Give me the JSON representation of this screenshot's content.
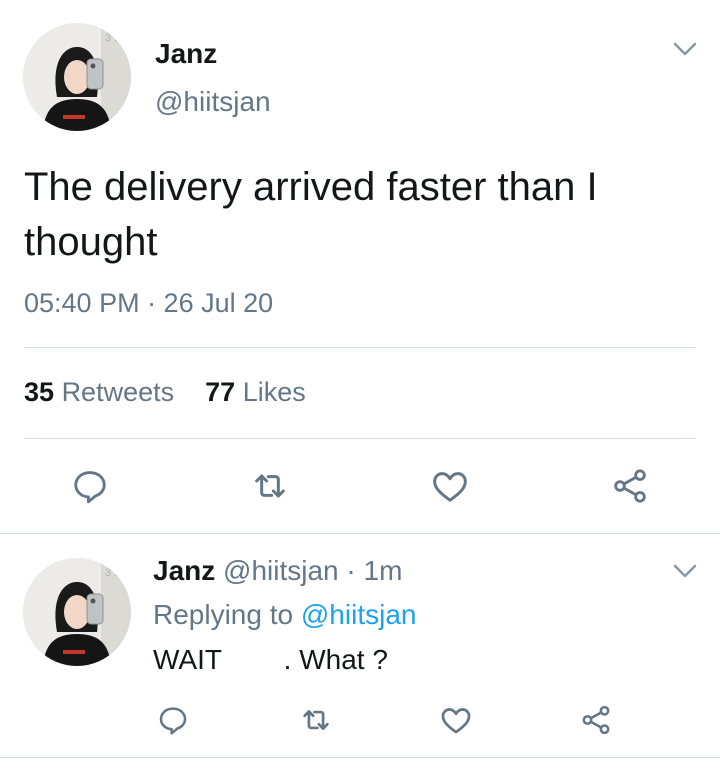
{
  "main_tweet": {
    "display_name": "Janz",
    "handle": "@hiitsjan",
    "text_line1": "The delivery arrived faster than I",
    "text_line2": "thought",
    "timestamp": "05:40 PM · 26 Jul 20",
    "retweets_count": "35",
    "retweets_label": "Retweets",
    "likes_count": "77",
    "likes_label": "Likes"
  },
  "reply": {
    "display_name": "Janz",
    "handle_time": "@hiitsjan · 1m",
    "replying_prefix": "Replying to",
    "replying_handle": "@hiitsjan",
    "text": "WAIT        . What ?"
  },
  "icons": {
    "reply": "reply-icon",
    "retweet": "retweet-icon",
    "like": "heart-icon",
    "share": "share-icon",
    "more": "chevron-down-icon"
  },
  "colors": {
    "text": "#14171a",
    "muted": "#657786",
    "link": "#1da1f2",
    "divider": "#d9dee2"
  }
}
